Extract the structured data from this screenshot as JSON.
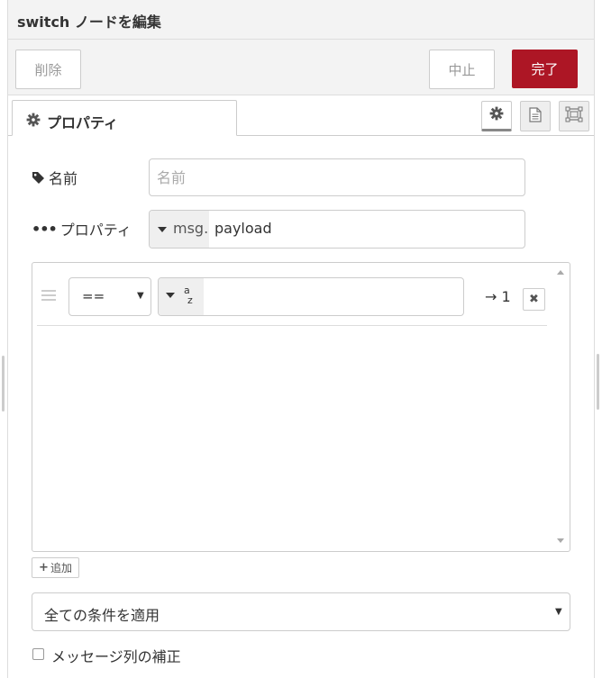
{
  "dialog": {
    "title": "switch ノードを編集"
  },
  "tray": {
    "delete_label": "削除",
    "cancel_label": "中止",
    "done_label": "完了"
  },
  "tabs": {
    "properties_label": "プロパティ",
    "icons": [
      "gear-icon",
      "description-icon",
      "appearance-icon"
    ]
  },
  "form": {
    "name_label": "名前",
    "name_placeholder": "名前",
    "name_value": "",
    "property_label": "プロパティ",
    "property_prefix": "msg.",
    "property_value": "payload"
  },
  "rules": [
    {
      "operator": "==",
      "value_type": "string",
      "value": "",
      "output": "→ 1"
    }
  ],
  "add_button_label": "追加",
  "checking_mode": {
    "selected": "全ての条件を適用"
  },
  "repair_sequence": {
    "label": "メッセージ列の補正",
    "checked": false
  },
  "colors": {
    "accent": "#ad1625",
    "border": "#cccccc",
    "panel": "#f3f3f3"
  }
}
